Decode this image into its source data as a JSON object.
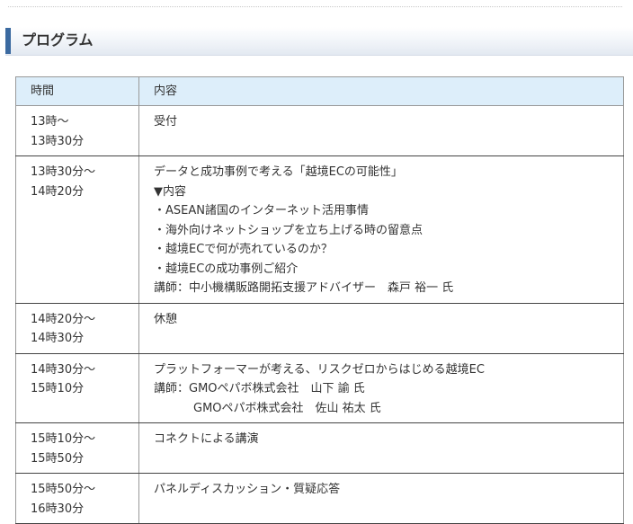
{
  "section": {
    "title": "プログラム"
  },
  "table": {
    "headers": {
      "time": "時間",
      "content": "内容"
    },
    "rows": [
      {
        "time": [
          "13時～",
          "13時30分"
        ],
        "content": [
          "受付"
        ]
      },
      {
        "time": [
          "13時30分～",
          "14時20分"
        ],
        "content": [
          "データと成功事例で考える「越境ECの可能性」",
          "▼内容",
          "・ASEAN諸国のインターネット活用事情",
          "・海外向けネットショップを立ち上げる時の留意点",
          "・越境ECで何が売れているのか？",
          "・越境ECの成功事例ご紹介",
          "講師：中小機構販路開拓支援アドバイザー　森戸 裕一 氏"
        ]
      },
      {
        "time": [
          "14時20分～",
          "14時30分"
        ],
        "content": [
          "休憩"
        ]
      },
      {
        "time": [
          "14時30分～",
          "15時10分"
        ],
        "content": [
          "プラットフォーマーが考える、リスクゼロからはじめる越境EC",
          "講師：GMOペパボ株式会社　山下 諭 氏"
        ],
        "content_indented": [
          "GMOペパボ株式会社　佐山 祐太 氏"
        ]
      },
      {
        "time": [
          "15時10分～",
          "15時50分"
        ],
        "content": [
          "コネクトによる講演"
        ]
      },
      {
        "time": [
          "15時50分～",
          "16時30分"
        ],
        "content": [
          "パネルディスカッション・質疑応答"
        ]
      }
    ]
  }
}
